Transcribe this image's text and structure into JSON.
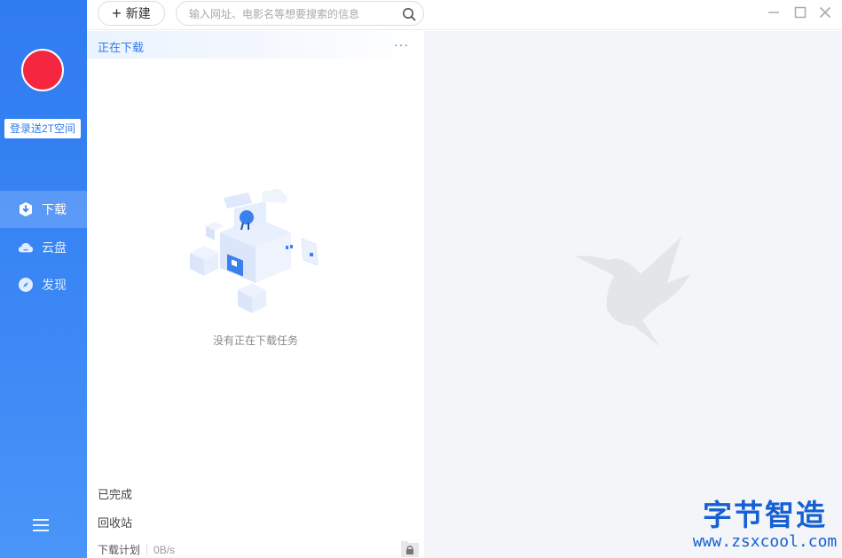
{
  "sidebar": {
    "login_label": "登录送2T空间",
    "nav": [
      {
        "label": "下载",
        "icon": "download-shield-icon",
        "active": true
      },
      {
        "label": "云盘",
        "icon": "cloud-icon",
        "active": false
      },
      {
        "label": "发现",
        "icon": "compass-icon",
        "active": false
      }
    ],
    "avatar_color": "#f5263f",
    "accent": "#2f7bf0"
  },
  "toolbar": {
    "new_label": "新建",
    "search_placeholder": "输入网址、电影名等想要搜索的信息"
  },
  "download_list": {
    "header_title": "正在下载",
    "more_label": "···",
    "empty_text": "没有正在下载任务",
    "completed_label": "已完成",
    "trash_label": "回收站",
    "plan_label": "下载计划",
    "speed": "0B/s"
  },
  "watermark": {
    "title": "字节智造",
    "url": "www.zsxcool.com"
  }
}
